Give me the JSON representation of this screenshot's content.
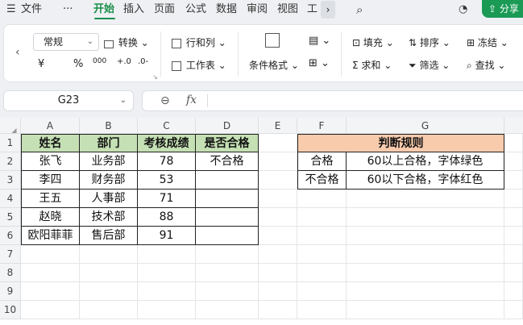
{
  "menu": {
    "file": "文件",
    "more": "···",
    "tabs": [
      "开始",
      "插入",
      "页面",
      "公式",
      "数据",
      "审阅",
      "视图",
      "工"
    ],
    "share": "分享"
  },
  "ribbon": {
    "number_format": "常规",
    "convert": "转换",
    "rows_cols": "行和列",
    "worksheet": "工作表",
    "conditional_format": "条件格式",
    "fill": "填充",
    "sort": "排序",
    "freeze": "冻结",
    "sum": "求和",
    "filter": "筛选",
    "find": "查找",
    "currency": "¥",
    "percent": "%",
    "thousands": "000"
  },
  "formula_bar": {
    "cell_ref": "G23",
    "fx": "fx",
    "value": ""
  },
  "columns": [
    "A",
    "B",
    "C",
    "D",
    "E",
    "F",
    "G"
  ],
  "rows": [
    "1",
    "2",
    "3",
    "4",
    "5",
    "6",
    "7",
    "8",
    "9",
    "10"
  ],
  "table1": {
    "headers": [
      "姓名",
      "部门",
      "考核成绩",
      "是否合格"
    ],
    "rows": [
      [
        "张飞",
        "业务部",
        "78",
        "不合格"
      ],
      [
        "李四",
        "财务部",
        "53",
        ""
      ],
      [
        "王五",
        "人事部",
        "71",
        ""
      ],
      [
        "赵晓",
        "技术部",
        "88",
        ""
      ],
      [
        "欧阳菲菲",
        "售后部",
        "91",
        ""
      ]
    ]
  },
  "table2": {
    "header": "判断规则",
    "rows": [
      [
        "合格",
        "60以上合格，字体绿色"
      ],
      [
        "不合格",
        "60以下合格，字体红色"
      ]
    ]
  }
}
